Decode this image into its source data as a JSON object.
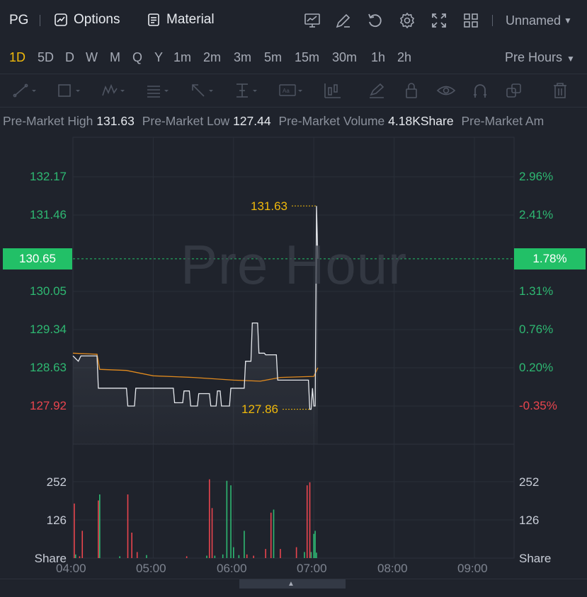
{
  "topbar": {
    "symbol": "PG",
    "options_label": "Options",
    "material_label": "Material",
    "layout_name": "Unnamed",
    "icons": [
      "chart-indicator-icon",
      "draw-edit-icon",
      "reset-icon",
      "settings-icon",
      "fullscreen-icon",
      "layout-grid-icon"
    ]
  },
  "periods": {
    "items": [
      "1D",
      "5D",
      "D",
      "W",
      "M",
      "Q",
      "Y",
      "1m",
      "2m",
      "3m",
      "5m",
      "15m",
      "30m",
      "1h",
      "2h"
    ],
    "active": "1D",
    "session_label": "Pre Hours"
  },
  "drawing_tools": [
    "line-tool-icon",
    "rectangle-tool-icon",
    "wave-tool-icon",
    "text-list-tool-icon",
    "arrow-tool-icon",
    "level-tool-icon",
    "label-tool-icon",
    "candle-tool-icon",
    "brush-tool-icon",
    "lock-icon",
    "eye-icon",
    "magnet-icon",
    "copy-icon",
    "trash-icon"
  ],
  "info": {
    "high_label": "Pre-Market High",
    "high_value": "131.63",
    "low_label": "Pre-Market Low",
    "low_value": "127.44",
    "volume_label": "Pre-Market Volume",
    "volume_value": "4.18KShare",
    "amount_label": "Pre-Market Am"
  },
  "chart": {
    "watermark": "Pre Hour",
    "current_price": "130.65",
    "current_pct": "1.78%",
    "high_marker": "131.63",
    "low_marker": "127.86",
    "price_axis": [
      {
        "label": "132.17",
        "color": "green"
      },
      {
        "label": "131.46",
        "color": "green"
      },
      {
        "label": "130.05",
        "color": "green"
      },
      {
        "label": "129.34",
        "color": "green"
      },
      {
        "label": "128.63",
        "color": "green"
      },
      {
        "label": "127.92",
        "color": "red"
      }
    ],
    "pct_axis": [
      {
        "label": "2.96%",
        "color": "green"
      },
      {
        "label": "2.41%",
        "color": "green"
      },
      {
        "label": "1.31%",
        "color": "green"
      },
      {
        "label": "0.76%",
        "color": "green"
      },
      {
        "label": "0.20%",
        "color": "green"
      },
      {
        "label": "-0.35%",
        "color": "red"
      }
    ],
    "volume_axis": [
      "252",
      "126",
      "Share"
    ],
    "time_axis": [
      "04:00",
      "05:00",
      "06:00",
      "07:00",
      "08:00",
      "09:00"
    ],
    "colors": {
      "up": "#2eb872",
      "down": "#e9454e",
      "price_line": "#e6e9ee",
      "avg_line": "#e08a1e",
      "marker": "#f0b90b"
    }
  },
  "chart_data": {
    "type": "line",
    "x_unit": "time",
    "series": [],
    "price_points": [
      [
        "04:00",
        128.85
      ],
      [
        "04:04",
        128.75
      ],
      [
        "04:06",
        128.85
      ],
      [
        "04:18",
        128.85
      ],
      [
        "04:19",
        128.25
      ],
      [
        "04:40",
        128.25
      ],
      [
        "04:41",
        127.92
      ],
      [
        "04:46",
        127.92
      ],
      [
        "04:47",
        128.25
      ],
      [
        "05:15",
        128.25
      ],
      [
        "05:16",
        127.98
      ],
      [
        "05:22",
        127.98
      ],
      [
        "05:23",
        128.2
      ],
      [
        "05:27",
        128.2
      ],
      [
        "05:28",
        127.92
      ],
      [
        "05:33",
        127.92
      ],
      [
        "05:34",
        128.15
      ],
      [
        "05:42",
        128.15
      ],
      [
        "05:43",
        127.92
      ],
      [
        "05:47",
        127.92
      ],
      [
        "05:48",
        128.2
      ],
      [
        "05:50",
        128.2
      ],
      [
        "05:51",
        127.92
      ],
      [
        "05:57",
        127.92
      ],
      [
        "05:58",
        128.25
      ],
      [
        "06:08",
        128.25
      ],
      [
        "06:09",
        128.75
      ],
      [
        "06:13",
        128.75
      ],
      [
        "06:14",
        129.46
      ],
      [
        "06:18",
        129.46
      ],
      [
        "06:19",
        128.9
      ],
      [
        "06:23",
        128.9
      ],
      [
        "06:24",
        128.87
      ],
      [
        "06:32",
        128.87
      ],
      [
        "06:33",
        128.4
      ],
      [
        "06:56",
        128.4
      ],
      [
        "06:57",
        127.86
      ],
      [
        "06:58",
        127.86
      ],
      [
        "06:59",
        128.25
      ],
      [
        "07:00",
        127.92
      ],
      [
        "07:01",
        127.92
      ],
      [
        "07:02",
        131.63
      ],
      [
        "07:03",
        130.65
      ]
    ],
    "avg_points": [
      [
        "04:00",
        128.9
      ],
      [
        "04:18",
        128.88
      ],
      [
        "04:20",
        128.6
      ],
      [
        "04:40",
        128.58
      ],
      [
        "05:00",
        128.48
      ],
      [
        "05:30",
        128.45
      ],
      [
        "06:00",
        128.4
      ],
      [
        "06:20",
        128.38
      ],
      [
        "06:35",
        128.45
      ],
      [
        "07:00",
        128.47
      ],
      [
        "07:03",
        128.63
      ]
    ],
    "volume_bars": [
      [
        "04:01",
        180,
        "down"
      ],
      [
        "04:02",
        12,
        "up"
      ],
      [
        "04:05",
        6,
        "down"
      ],
      [
        "04:07",
        90,
        "down"
      ],
      [
        "04:19",
        190,
        "down"
      ],
      [
        "04:20",
        210,
        "up"
      ],
      [
        "04:35",
        6,
        "up"
      ],
      [
        "04:41",
        210,
        "down"
      ],
      [
        "04:44",
        84,
        "down"
      ],
      [
        "04:48",
        20,
        "down"
      ],
      [
        "04:55",
        10,
        "up"
      ],
      [
        "05:25",
        6,
        "down"
      ],
      [
        "05:40",
        8,
        "up"
      ],
      [
        "05:42",
        260,
        "down"
      ],
      [
        "05:44",
        165,
        "down"
      ],
      [
        "05:46",
        8,
        "up"
      ],
      [
        "05:52",
        12,
        "up"
      ],
      [
        "05:55",
        255,
        "up"
      ],
      [
        "05:58",
        240,
        "up"
      ],
      [
        "06:00",
        36,
        "up"
      ],
      [
        "06:04",
        10,
        "up"
      ],
      [
        "06:08",
        90,
        "up"
      ],
      [
        "06:10",
        12,
        "down"
      ],
      [
        "06:15",
        8,
        "down"
      ],
      [
        "06:24",
        30,
        "down"
      ],
      [
        "06:28",
        150,
        "down"
      ],
      [
        "06:30",
        160,
        "up"
      ],
      [
        "06:35",
        30,
        "down"
      ],
      [
        "06:47",
        36,
        "down"
      ],
      [
        "06:53",
        20,
        "up"
      ],
      [
        "06:55",
        240,
        "down"
      ],
      [
        "06:57",
        250,
        "down"
      ],
      [
        "06:58",
        20,
        "up"
      ],
      [
        "07:00",
        80,
        "up"
      ],
      [
        "07:01",
        90,
        "up"
      ],
      [
        "07:02",
        18,
        "up"
      ]
    ],
    "ylim_price": [
      127.5,
      132.5
    ],
    "ylim_volume": [
      0,
      280
    ],
    "xlim": [
      "04:00",
      "09:30"
    ]
  }
}
